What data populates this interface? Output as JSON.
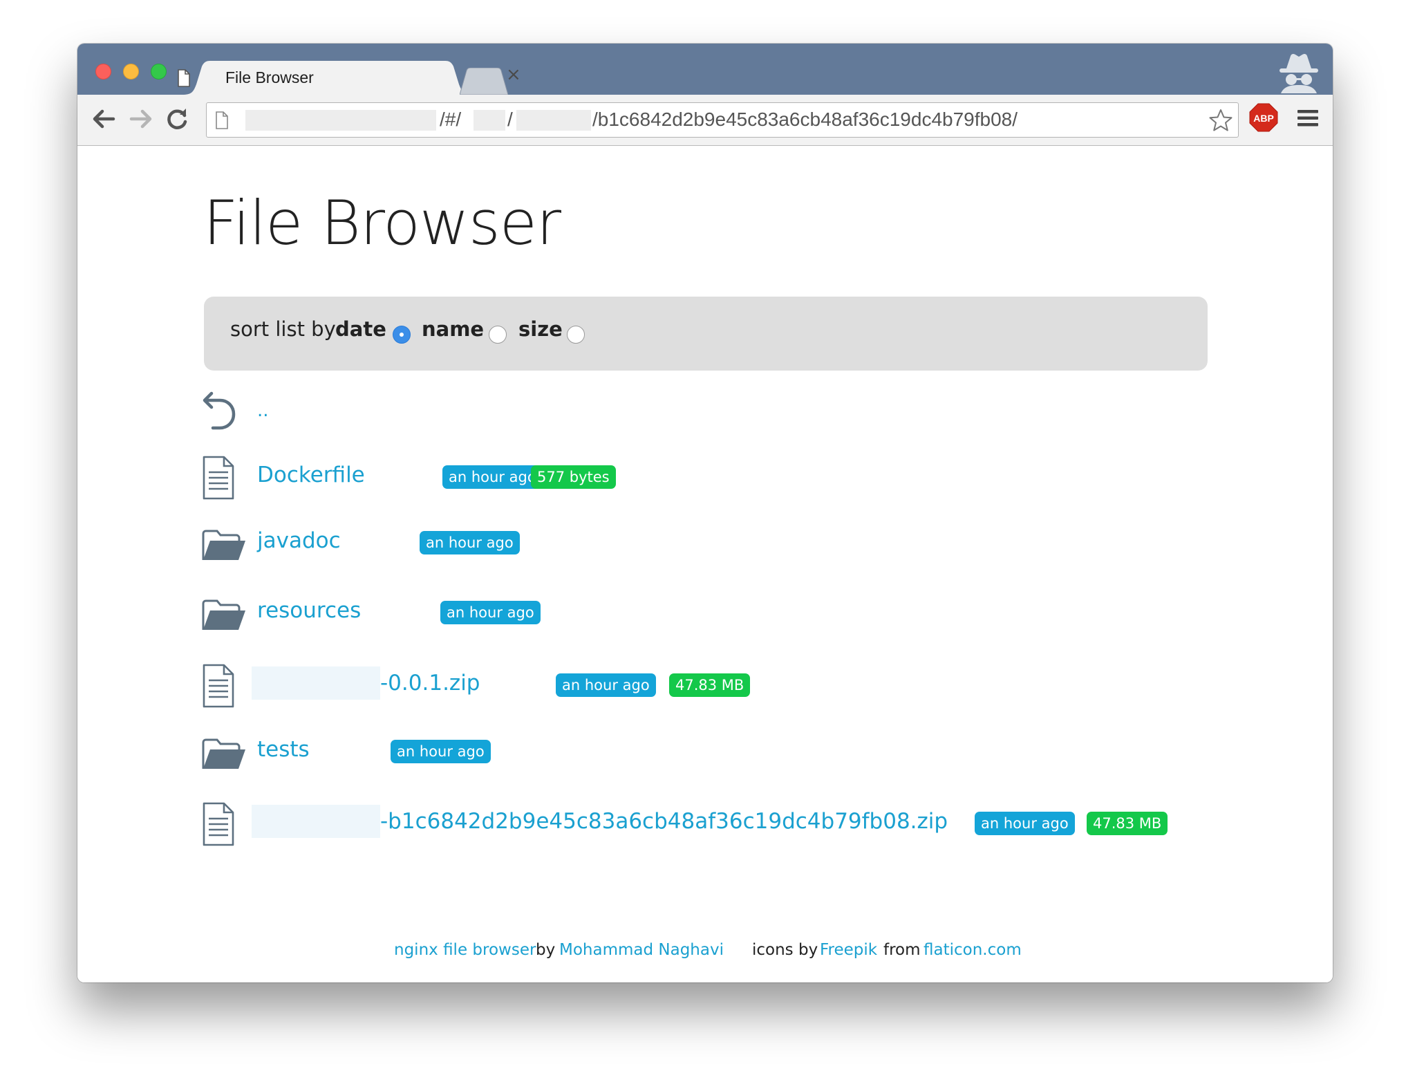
{
  "browser": {
    "tab_title": "File Browser",
    "tab_close": "×",
    "url_parts": [
      "/#/",
      "/",
      "/b1c6842d2b9e45c83a6cb48af36c19dc4b79fb08/"
    ],
    "abp_label": "ABP"
  },
  "page": {
    "title": "File Browser"
  },
  "sort": {
    "prefix": "sort list by",
    "options": [
      {
        "label": "date",
        "checked": true
      },
      {
        "label": "name",
        "checked": false
      },
      {
        "label": "size",
        "checked": false
      }
    ]
  },
  "entries": [
    {
      "type": "parent",
      "name": ".."
    },
    {
      "type": "file",
      "name": "Dockerfile",
      "date": "an hour ago",
      "size": "577 bytes"
    },
    {
      "type": "folder",
      "name": "javadoc",
      "date": "an hour ago"
    },
    {
      "type": "folder",
      "name": "resources",
      "date": "an hour ago"
    },
    {
      "type": "file",
      "name": "-0.0.1.zip",
      "date": "an hour ago",
      "size": "47.83 MB",
      "redacted_prefix": true
    },
    {
      "type": "folder",
      "name": "tests",
      "date": "an hour ago"
    },
    {
      "type": "file",
      "name": "-b1c6842d2b9e45c83a6cb48af36c19dc4b79fb08.zip",
      "date": "an hour ago",
      "size": "47.83 MB",
      "redacted_prefix": true
    }
  ],
  "footer": {
    "project_link": "nginx file browser",
    "by1": "by",
    "author": "Mohammad Naghavi",
    "icons_by": "icons by",
    "icons_author": "Freepik",
    "from": "from",
    "site": "flaticon.com"
  },
  "colors": {
    "titlebar": "#637a99",
    "link": "#1aa0d0",
    "date_badge": "#14a4d8",
    "size_badge": "#14c84a",
    "sortbar": "#dedede",
    "icon": "#5d7080"
  }
}
